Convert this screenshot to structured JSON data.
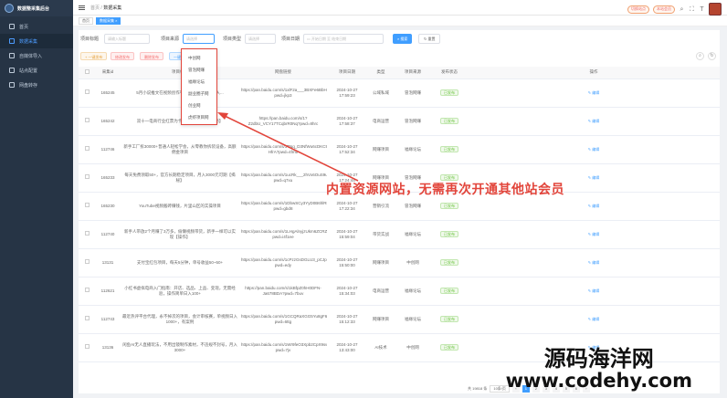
{
  "app": {
    "title": "数据整采集后台"
  },
  "sidebar": {
    "items": [
      {
        "label": "首页",
        "icon": "home-icon"
      },
      {
        "label": "数据采集",
        "icon": "database-icon"
      },
      {
        "label": "自媒体导入",
        "icon": "import-icon"
      },
      {
        "label": "站点配置",
        "icon": "config-icon"
      },
      {
        "label": "网盘转存",
        "icon": "cloud-icon"
      }
    ]
  },
  "header": {
    "crumb_home": "首页",
    "crumb_current": "数据采集",
    "pill1": "切换站点",
    "pill2": "本站会员"
  },
  "tags": {
    "home": "首页",
    "current": "数据采集 ×"
  },
  "filters": {
    "title_label": "项目标题",
    "title_placeholder": "请输入标题",
    "source_label": "项目来源",
    "source_value": "请选择",
    "type_label": "项目类型",
    "type_placeholder": "请选择",
    "date_label": "项目日期",
    "date_start": "开始日期",
    "date_sep": "至",
    "date_end": "结束日期",
    "search": "搜索",
    "reset": "重置"
  },
  "ops": {
    "add": "+ 一键发布",
    "mod": "修改发布",
    "del": "删除发布",
    "exp": "一键导入"
  },
  "table": {
    "headers": [
      "",
      "采集id",
      "项目标题",
      "网盘链接",
      "项目日期",
      "类型",
      "项目来源",
      "发布状态",
      "操作"
    ],
    "rows": [
      {
        "id": "165245",
        "title": "5月小说推文在视频创作平台...人人可做，日入...",
        "link": "https://pan.baidu.com/s/1xlF2a___3BXFe6BbH0o4g?pwd=jkp3",
        "date": "2024-10-27 17:59:23",
        "type": "公域私域",
        "source": "冒泡网赚",
        "status": "已发布",
        "action": "编辑"
      },
      {
        "id": "165242",
        "title": "双十一电商行业红票为卡点，有手就会【揭秘】",
        "link": "https://pan.baidu.com/s/1?Z2dbU_VCY17TCqbrR0Nq?pwd=8hrc",
        "date": "2024-10-27 17:58:37",
        "type": "电商运营",
        "source": "冒泡网赚",
        "status": "已发布",
        "action": "编辑"
      },
      {
        "id": "112746",
        "title": "新手工厂拆30000+普通人轻松学会，从零教你拆装设备，高额佣金项目",
        "link": "https://pan.baidu.com/s/1TNq_D3NfWu6cDKC9x-HfrA?pwd=4fmb",
        "date": "2024-10-27 17:52:34",
        "type": "网赚项目",
        "source": "福缘论坛",
        "status": "已发布",
        "action": "编辑"
      },
      {
        "id": "165233",
        "title": "每天免费领取50+，官方长期稳定项目，月入3000元可期【揭秘】",
        "link": "https://pan.baidu.com/s/1ucRk___2hVx6OuS9u7Dwc4k?pwd=q7xu",
        "date": "2024-10-27 17:24:44",
        "type": "网赚项目",
        "source": "冒泡网赚",
        "status": "已发布",
        "action": "编辑"
      },
      {
        "id": "165230",
        "title": "YouTube视频搬砖赚钱，片里山区的实操项目",
        "link": "https://pan.baidu.com/s/1DbwSCy3YyD0B6hlRBnw?pwd=gbd8",
        "date": "2024-10-27 17:22:34",
        "type": "营销引流",
        "source": "冒泡网赚",
        "status": "已发布",
        "action": "编辑"
      },
      {
        "id": "112740",
        "title": "新手人带放2个月赚了3万多，偷懒视频带货，新手一样可以实现【操作】",
        "link": "https://pan.baidu.com/s/1LHgAlnyjzUkm6ZCRZ4Kg?pwd=i4f1ee",
        "date": "2024-10-27 15:59:04",
        "type": "带货实战",
        "source": "福缘论坛",
        "status": "已发布",
        "action": "编辑"
      },
      {
        "id": "13131",
        "title": "支付宝红包项目，每天5分钟，单号收益50~50+",
        "link": "https://pan.baidu.com/s/1cPzzGsDGLU3_pCJpEsUk2Q?pwd=edy",
        "date": "2024-10-27 15:50:00",
        "type": "网赚项目",
        "source": "中创网",
        "status": "已发布",
        "action": "编辑"
      },
      {
        "id": "112621",
        "title": "小红书虚拟电商入门指南：开店、选品、上品、变现，无需经验，操作简单日入100+",
        "link": "https://pan.baidu.com/s/1kBfpZ0hH0DFN-Ja678BDA?pwd=7buv",
        "date": "2024-10-27 15:34:03",
        "type": "电商运营",
        "source": "福缘论坛",
        "status": "已发布",
        "action": "编辑"
      },
      {
        "id": "112743",
        "title": "最近热评平台代理，永不掉次的项目，会计审核赛，单视频日入1000+，有案例",
        "link": "https://pan.baidu.com/s/1GCQRaXGG5Yu8gF6LnjJA?pwd=6ttg",
        "date": "2024-10-27 15:12:33",
        "type": "网赚项目",
        "source": "福缘论坛",
        "status": "已发布",
        "action": "编辑"
      },
      {
        "id": "13136",
        "title": "闲鱼AI无人直播玩法，不用出镜制作素材，不违规不封号，月入3000+",
        "link": "https://pan.baidu.com/s/1Wr9feO3Xpb2CpX9swW2Q?pwd=7jv",
        "date": "2024-10-27 13:43:00",
        "type": "AI技术",
        "source": "中创网",
        "status": "已发布",
        "action": "编辑"
      }
    ]
  },
  "pager": {
    "total": "共 19818 条",
    "size": "10条/页",
    "pages": [
      "1",
      "2",
      "3",
      "4",
      "5",
      "6"
    ]
  },
  "dropdown": {
    "items": [
      "中创网",
      "冒泡网赚",
      "福缘论坛",
      "副业圈子网",
      "创业网",
      "虎虾项目网"
    ]
  },
  "annotation": "内置资源网站，无需再次开通其他站会员",
  "watermark": {
    "line1": "源码海洋网",
    "line2": "www.codehy.com"
  },
  "colors": {
    "primary": "#409eff",
    "sidebar": "#263445",
    "annot": "#e2453b"
  }
}
